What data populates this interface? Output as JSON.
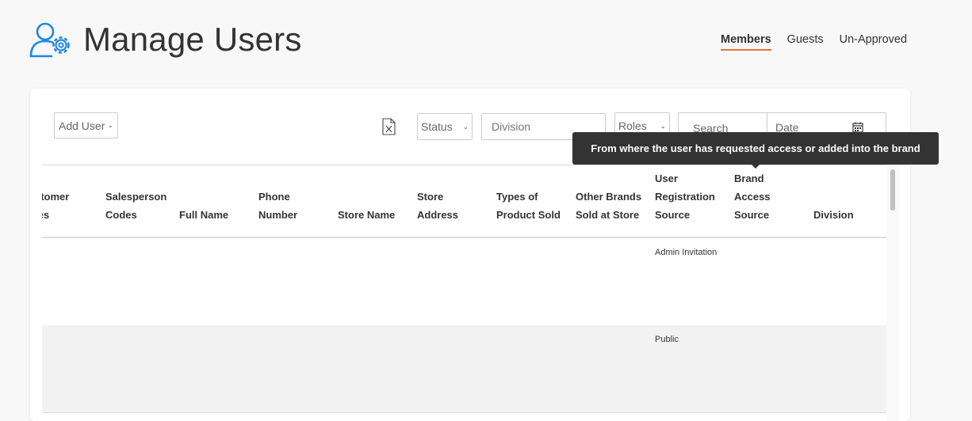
{
  "header": {
    "title": "Manage Users",
    "icon": "user-gear-icon",
    "accent_color": "#1e88e5"
  },
  "tabs": [
    {
      "label": "Members",
      "active": true
    },
    {
      "label": "Guests",
      "active": false
    },
    {
      "label": "Un-Approved",
      "active": false
    }
  ],
  "toolbar": {
    "add_user_label": "Add User",
    "status_label": "Status",
    "division_placeholder": "Division",
    "roles_label": "Roles",
    "search_placeholder": "Search",
    "date_placeholder": "Date"
  },
  "table": {
    "columns": [
      [
        "stomer",
        "les"
      ],
      [
        "Salesperson",
        "Codes"
      ],
      [
        "Full Name"
      ],
      [
        "Phone",
        "Number"
      ],
      [
        "Store Name"
      ],
      [
        "Store",
        "Address"
      ],
      [
        "Types of",
        "Product Sold"
      ],
      [
        "Other Brands",
        "Sold at Store"
      ],
      [
        "User",
        "Registration",
        "Source"
      ],
      [
        "Brand",
        "Access",
        "Source"
      ],
      [
        "Division"
      ]
    ],
    "rows": [
      {
        "registration_source": "Admin Invitation"
      },
      {
        "registration_source": "Public"
      }
    ]
  },
  "tooltip": {
    "text": "From where the user has requested access or added into the brand"
  },
  "colors": {
    "tab_underline": "#e8733a",
    "tooltip_bg": "#333333"
  }
}
